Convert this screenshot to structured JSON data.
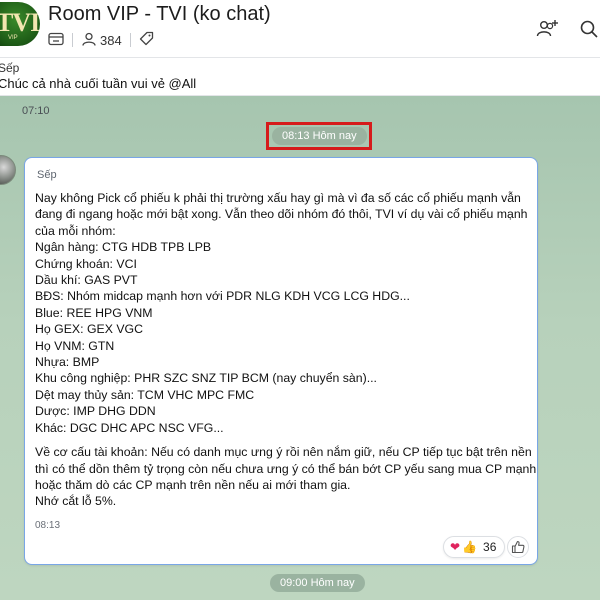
{
  "header": {
    "avatar_logo": "TVI",
    "avatar_sub": "VIP",
    "title": "Room VIP - TVI (ko chat)",
    "member_count": "384",
    "icons": [
      "community-icon",
      "members-icon",
      "tag-icon",
      "add-member-icon",
      "search-icon"
    ]
  },
  "pinned": {
    "sender": "Sếp",
    "text": "Chúc cả nhà cuối tuần vui vẻ @All"
  },
  "chat": {
    "prev_time": "07:10",
    "date_divider_1": "08:13 Hôm nay",
    "date_divider_2": "09:00 Hôm nay",
    "highlight_color": "#d61b1b",
    "message": {
      "sender": "Sếp",
      "lines": [
        "Nay không Pick cổ phiếu k phải thị trường xấu hay gì mà vì đa số các cổ phiếu mạnh vẫn",
        "đang đi ngang hoặc mới bật xong. Vẫn theo dõi nhóm đó thôi, TVI ví dụ vài cổ phiếu mạnh",
        "của mỗi nhóm:",
        "Ngân hàng: CTG HDB TPB LPB",
        "Chứng khoán: VCI",
        "Dầu khí: GAS PVT",
        "BĐS: Nhóm midcap mạnh hơn với PDR NLG KDH VCG LCG HDG...",
        "Blue: REE HPG VNM",
        "Họ GEX: GEX VGC",
        "Họ VNM: GTN",
        "Nhựa: BMP",
        "Khu công nghiệp: PHR SZC SNZ TIP BCM (nay chuyển sàn)...",
        "Dệt may thủy sản: TCM VHC MPC FMC",
        "Dược: IMP DHG DDN",
        "Khác: DGC DHC APC NSC VFG...",
        "",
        "Về cơ cấu tài khoản: Nếu có danh mục ưng ý rồi nên nắm giữ, nếu CP tiếp tục bật trên nền",
        "thì có thể dồn thêm tỷ trọng còn nếu chưa ưng ý có thể bán bớt CP yếu sang mua CP mạnh",
        "hoặc thăm dò các CP mạnh trên nền nếu ai mới tham gia.",
        "Nhớ cắt lỗ 5%."
      ],
      "time": "08:13",
      "reactions": {
        "emojis": [
          "❤",
          "👍"
        ],
        "count": "36"
      },
      "like_icon": "thumbs-up-icon"
    }
  }
}
